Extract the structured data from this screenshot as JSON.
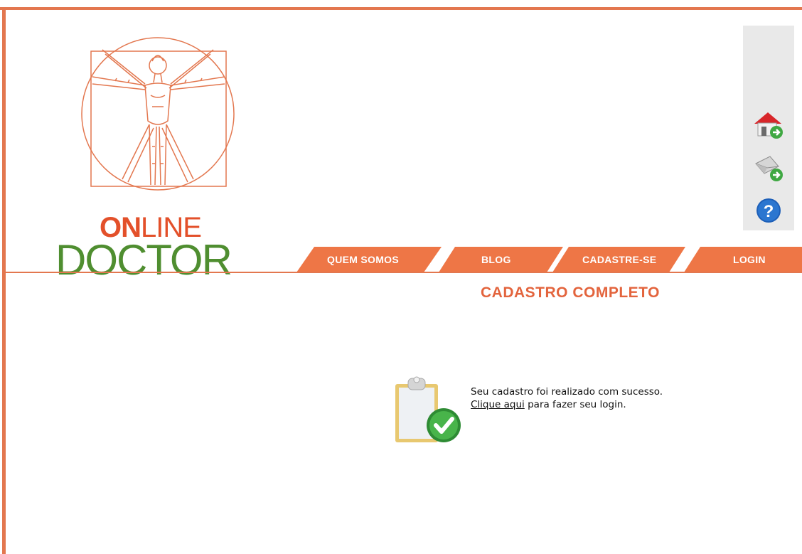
{
  "logo": {
    "online_bold": "ON",
    "online_rest": "LINE",
    "doctor": "DOCTOR"
  },
  "side_panel": {
    "icons": [
      "home-go-icon",
      "mail-go-icon",
      "help-icon"
    ]
  },
  "nav": {
    "items": [
      {
        "label": "QUEM SOMOS"
      },
      {
        "label": "BLOG"
      },
      {
        "label": "CADASTRE-SE"
      },
      {
        "label": "LOGIN"
      }
    ]
  },
  "page_title": "CADASTRO COMPLETO",
  "message": {
    "line1": "Seu cadastro foi realizado com sucesso.",
    "link": "Clique aqui",
    "line2_rest": " para fazer seu login."
  },
  "colors": {
    "accent_orange": "#e3774f",
    "title_orange": "#e3643d",
    "logo_red": "#e3502a",
    "logo_green": "#4f8e30"
  }
}
